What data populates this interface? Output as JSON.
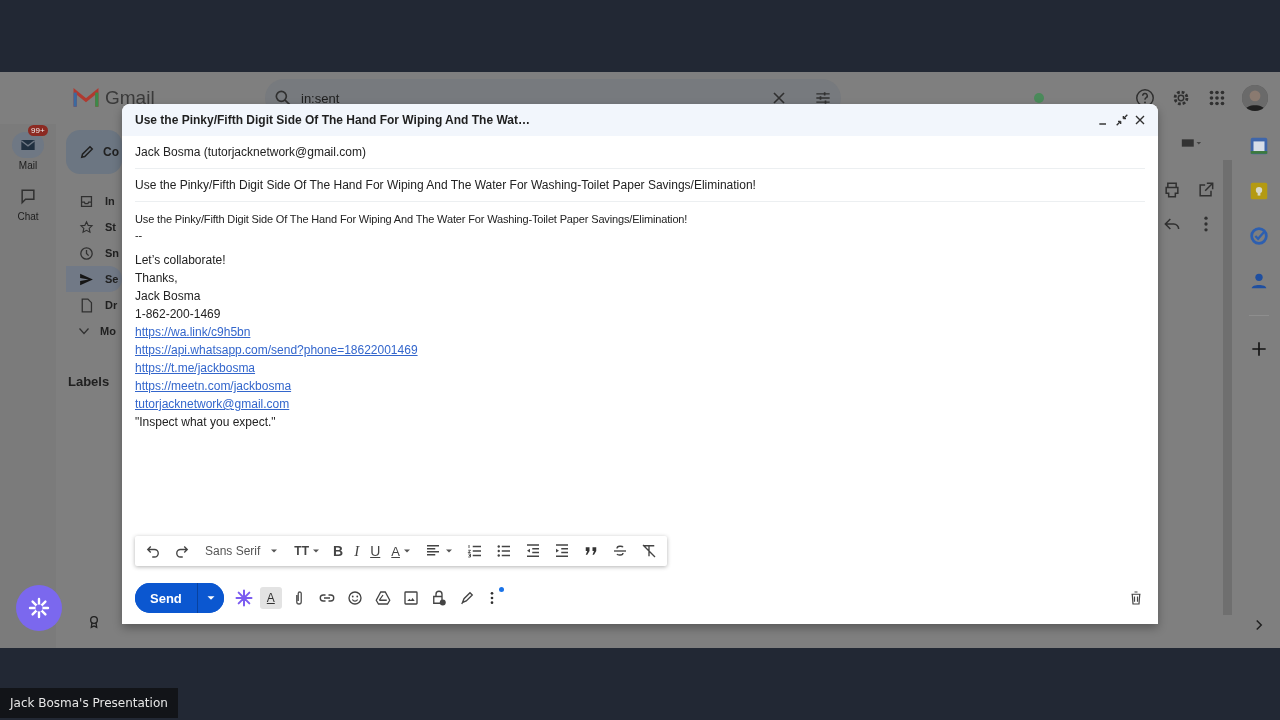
{
  "gmail": {
    "logo_text": "Gmail",
    "search": {
      "value": "in:sent"
    },
    "rail": [
      {
        "label": "Mail",
        "badge": "99+",
        "selected": true
      },
      {
        "label": "Chat",
        "selected": false
      }
    ],
    "compose_button": "Co",
    "nav": [
      {
        "label": "In",
        "selected": false
      },
      {
        "label": "St",
        "selected": false
      },
      {
        "label": "Sn",
        "selected": false
      },
      {
        "label": "Se",
        "selected": true
      },
      {
        "label": "Dr",
        "selected": false
      },
      {
        "label": "Mo",
        "selected": false
      }
    ],
    "labels_heading": "Labels"
  },
  "compose": {
    "title": "Use the Pinky/Fifth Digit Side Of The Hand For Wiping And The Wat…",
    "from": "Jack Bosma (tutorjacknetwork@gmail.com)",
    "subject": "Use the Pinky/Fifth Digit Side Of The Hand For Wiping And The Water For Washing-Toilet Paper Savings/Elimination!",
    "body": [
      {
        "kind": "small",
        "text": "Use the Pinky/Fifth Digit Side Of The Hand For Wiping And The Water For Washing-Toilet Paper Savings/Elimination!"
      },
      {
        "kind": "small",
        "text": "--"
      },
      {
        "kind": "text",
        "text": "Let’s collaborate!"
      },
      {
        "kind": "text",
        "text": "Thanks,"
      },
      {
        "kind": "text",
        "text": "Jack Bosma"
      },
      {
        "kind": "text",
        "text": "1-862-200-1469"
      },
      {
        "kind": "link",
        "text": "https://wa.link/c9h5bn"
      },
      {
        "kind": "link",
        "text": "https://api.whatsapp.com/send?phone=18622001469"
      },
      {
        "kind": "link",
        "text": "https://t.me/jackbosma"
      },
      {
        "kind": "link",
        "text": "https://meetn.com/jackbosma"
      },
      {
        "kind": "link",
        "text": "tutorjacknetwork@gmail.com"
      },
      {
        "kind": "text",
        "text": "\"Inspect what you expect.\""
      }
    ],
    "format_bar": [
      {
        "kind": "undo"
      },
      {
        "kind": "redo"
      },
      {
        "kind": "font",
        "text": "Sans Serif"
      },
      {
        "kind": "size",
        "text": "TT"
      },
      {
        "kind": "bold",
        "text": "B"
      },
      {
        "kind": "italic",
        "text": "I"
      },
      {
        "kind": "underline",
        "text": "U"
      },
      {
        "kind": "color",
        "text": "A"
      },
      {
        "kind": "align"
      },
      {
        "kind": "numbered"
      },
      {
        "kind": "bulleted"
      },
      {
        "kind": "outdent"
      },
      {
        "kind": "indent"
      },
      {
        "kind": "quote"
      },
      {
        "kind": "strike"
      },
      {
        "kind": "clear"
      }
    ],
    "send_label": "Send",
    "formatting_toggle": {
      "text": "A",
      "selected": true
    }
  },
  "presentation_label": "Jack Bosma's Presentation"
}
